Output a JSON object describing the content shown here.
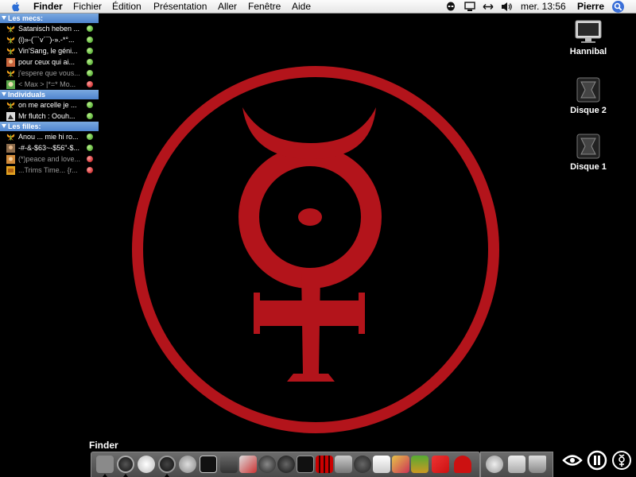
{
  "menubar": {
    "app_name": "Finder",
    "menus": [
      "Fichier",
      "Édition",
      "Présentation",
      "Aller",
      "Fenêtre",
      "Aide"
    ],
    "clock": "mer. 13:56",
    "user": "Pierre"
  },
  "buddy_list": {
    "groups": [
      {
        "name": "Les mecs:",
        "buddies": [
          {
            "name": "Satanisch heben ...",
            "status": "available",
            "avatar": "butterfly-icon"
          },
          {
            "name": "(l)»-(¯`v´¯)-».-*°...",
            "status": "available",
            "avatar": "butterfly-icon"
          },
          {
            "name": "Vin'Sang, le géni...",
            "status": "available",
            "avatar": "butterfly-icon"
          },
          {
            "name": "pour ceux qui ai...",
            "status": "available",
            "avatar": "photo-avatar"
          },
          {
            "name": "j'espere que vous...",
            "status": "away",
            "avatar": "butterfly-icon"
          },
          {
            "name": "< Max > |*=* Mo...",
            "status": "away",
            "avatar": "cartoon-avatar"
          }
        ]
      },
      {
        "name": "Individuals",
        "buddies": [
          {
            "name": "on me arcelle je ...",
            "status": "available",
            "avatar": "butterfly-icon"
          },
          {
            "name": "Mr flutch : Oouh...",
            "status": "available",
            "avatar": "photo-avatar"
          }
        ]
      },
      {
        "name": "Les filles:",
        "buddies": [
          {
            "name": "Anou ... mie hi ro...",
            "status": "available",
            "avatar": "butterfly-icon"
          },
          {
            "name": "-#-&-$63~-$56\"-$...",
            "status": "available",
            "avatar": "photo-avatar"
          },
          {
            "name": "(*)peace and love...",
            "status": "away",
            "avatar": "photo-avatar"
          },
          {
            "name": "...Trims Time... {r...",
            "status": "away",
            "avatar": "photo-avatar"
          }
        ]
      }
    ]
  },
  "desktop_icons": [
    {
      "label": "Hannibal",
      "icon": "monitor-icon"
    },
    {
      "label": "Disque 2",
      "icon": "hard-drive-icon"
    },
    {
      "label": "Disque 1",
      "icon": "hard-drive-icon"
    }
  ],
  "dock": {
    "label": "Finder",
    "items": [
      {
        "icon": "finder-icon",
        "running": true
      },
      {
        "icon": "dashboard-icon",
        "running": true
      },
      {
        "icon": "dvd-player-icon",
        "running": false
      },
      {
        "icon": "safari-icon",
        "running": true
      },
      {
        "icon": "sync-icon",
        "running": false
      },
      {
        "icon": "terminal-icon",
        "running": false
      },
      {
        "icon": "ichat-icon",
        "running": false
      },
      {
        "icon": "photos-icon",
        "running": false
      },
      {
        "icon": "compass-icon",
        "running": false
      },
      {
        "icon": "globe-icon",
        "running": false
      },
      {
        "icon": "apple-icon",
        "running": false
      },
      {
        "icon": "film-icon",
        "running": false
      },
      {
        "icon": "speaker-icon",
        "running": false
      },
      {
        "icon": "refresh-icon",
        "running": false
      },
      {
        "icon": "documents-icon",
        "running": false
      },
      {
        "icon": "address-book-icon",
        "running": false
      },
      {
        "icon": "pineapple-icon",
        "running": false
      },
      {
        "icon": "tiles-icon",
        "running": false
      },
      {
        "icon": "robot-icon",
        "running": false
      }
    ],
    "right_items": [
      {
        "icon": "mail-icon"
      },
      {
        "icon": "folder-icon"
      },
      {
        "icon": "trash-icon"
      }
    ]
  },
  "colors": {
    "desktop": "#000000",
    "symbol_red": "#b3141b",
    "group_header": "#5b8ed6",
    "status_available": "#3a9a1c",
    "status_away": "#c21010"
  }
}
